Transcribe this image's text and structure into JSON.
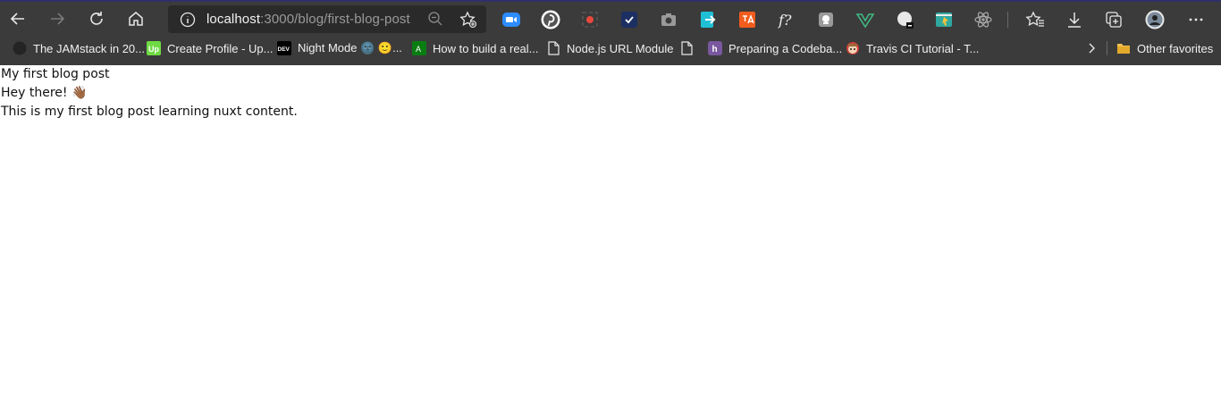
{
  "browser": {
    "url_host": "localhost",
    "url_path": ":3000/blog/first-blog-post",
    "nav": {
      "back_icon": "back-arrow-icon",
      "forward_icon": "forward-arrow-icon",
      "refresh_icon": "refresh-icon",
      "home_icon": "home-icon"
    },
    "extensions": [
      "zoom-icon",
      "pinterest-icon",
      "screen-recorder-icon",
      "check-task-icon",
      "camera-icon",
      "share-arrow-icon",
      "translate-icon",
      "formula-icon",
      "note-icon",
      "vue-icon",
      "devtools-icon",
      "window-icon",
      "react-icon"
    ],
    "right_icons": [
      "favorites-icon",
      "downloads-icon",
      "collections-icon",
      "profile-avatar",
      "more-menu-icon"
    ]
  },
  "bookmarks": {
    "items": [
      {
        "label": "The JAMstack in 20...",
        "icon": "dark-circle-icon"
      },
      {
        "label": "Create Profile - Up...",
        "icon": "upwork-icon"
      },
      {
        "label": "Night Mode 🌚 🙂...",
        "icon": "dev-icon"
      },
      {
        "label": "How to build a real...",
        "icon": "green-a-icon"
      },
      {
        "label": "Node.js URL Module",
        "icon": "page-icon"
      },
      {
        "label": "",
        "icon": "page-icon"
      },
      {
        "label": "Preparing a Codeba...",
        "icon": "heroku-icon"
      },
      {
        "label": "Travis CI Tutorial - T...",
        "icon": "travis-icon"
      }
    ],
    "overflow_icon": "chevron-right-icon",
    "other_favorites": "Other favorites"
  },
  "page": {
    "title": "My first blog post",
    "greeting": "Hey there! 👋🏾",
    "body": "This is my first blog post learning nuxt content."
  },
  "colors": {
    "chrome_bg": "#3b3b3b",
    "address_bg": "#2a2a2a",
    "page_bg": "#ffffff"
  }
}
